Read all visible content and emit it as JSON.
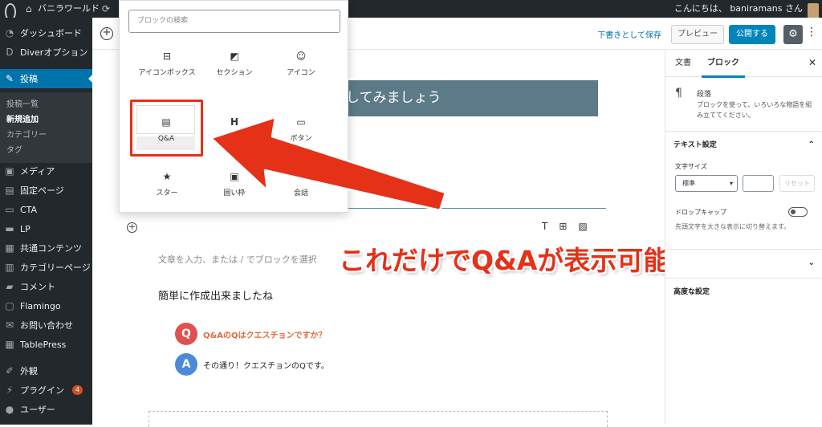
{
  "admin_bar": {
    "site_name": "バニラワールド",
    "greeting": "こんにちは、 baniramans さん"
  },
  "sidebar": {
    "items": [
      {
        "label": "ダッシュボード",
        "icon": "dashboard-icon"
      },
      {
        "label": "Diverオプション",
        "icon": "diver-icon"
      },
      {
        "label": "投稿",
        "icon": "pin-icon"
      },
      {
        "label": "メディア",
        "icon": "media-icon"
      },
      {
        "label": "固定ページ",
        "icon": "page-icon"
      },
      {
        "label": "CTA",
        "icon": "cta-icon"
      },
      {
        "label": "LP",
        "icon": "lp-icon"
      },
      {
        "label": "共通コンテンツ",
        "icon": "content-icon"
      },
      {
        "label": "カテゴリーページ",
        "icon": "category-page-icon"
      },
      {
        "label": "コメント",
        "icon": "comment-icon"
      },
      {
        "label": "Flamingo",
        "icon": "flamingo-icon"
      },
      {
        "label": "お問い合わせ",
        "icon": "mail-icon"
      },
      {
        "label": "TablePress",
        "icon": "table-icon"
      },
      {
        "label": "外観",
        "icon": "brush-icon"
      },
      {
        "label": "プラグイン",
        "icon": "plugin-icon",
        "badge": "4"
      },
      {
        "label": "ユーザー",
        "icon": "user-icon"
      }
    ],
    "submenu": [
      "投稿一覧",
      "新規追加",
      "カテゴリー",
      "タグ"
    ]
  },
  "header": {
    "save_draft": "下書きとして保存",
    "preview": "プレビュー",
    "publish": "公開する"
  },
  "inserter": {
    "search_placeholder": "ブロックの検索",
    "blocks": [
      {
        "label": "アイコンボックス",
        "icon": "iconbox-icon"
      },
      {
        "label": "セクション",
        "icon": "section-icon"
      },
      {
        "label": "アイコン",
        "icon": "smile-icon"
      },
      {
        "label": "Q&A",
        "icon": "qa-icon"
      },
      {
        "label": "H",
        "icon": "heading-icon"
      },
      {
        "label": "ボタン",
        "icon": "button-icon"
      },
      {
        "label": "スター",
        "icon": "star-icon"
      },
      {
        "label": "囲い枠",
        "icon": "box-frame-icon"
      },
      {
        "label": "会話",
        "icon": "conversation-icon"
      }
    ]
  },
  "content": {
    "heading_text": "く入力してみましょう",
    "placeholder": "文章を入力、または / でブロックを選択",
    "paragraph": "簡単に作成出来ましたね",
    "q_letter": "Q",
    "q_text": "Q&AのQはクエスチョンですか？",
    "a_letter": "A",
    "a_text": "その通り！クエスチョンのQです。"
  },
  "callout": "これだけでQ&Aが表示可能",
  "panel": {
    "tab_document": "文書",
    "tab_block": "ブロック",
    "block_name": "段落",
    "block_desc": "ブロックを使って、いろいろな物語を組み立ててください。",
    "text_settings": "テキスト設定",
    "font_size_label": "文字サイズ",
    "font_size_value": "標準",
    "reset": "リセット",
    "drop_cap": "ドロップキャップ",
    "drop_cap_help": "先頭文字を大きな表示に切り替えます。",
    "advanced": "高度な設定"
  },
  "colors": {
    "accent": "#0085ba",
    "highlight_red": "#e53118",
    "admin_dark": "#23282d"
  }
}
